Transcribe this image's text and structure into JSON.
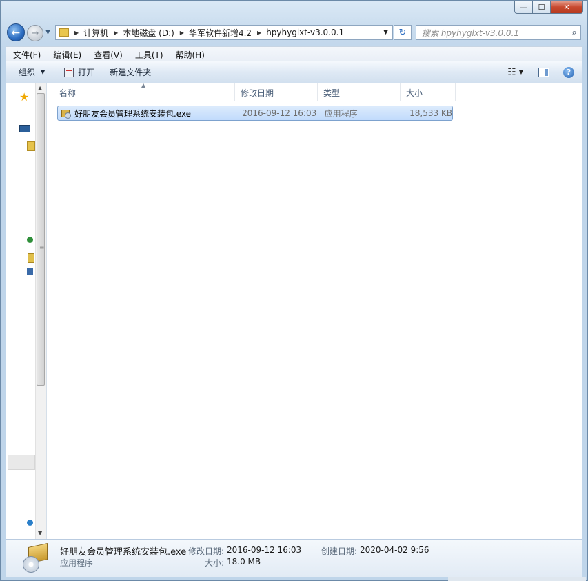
{
  "window": {
    "caption": {
      "minimize": "—",
      "maximize": "☐",
      "close": "✕"
    }
  },
  "nav": {
    "back_glyph": "←",
    "forward_glyph": "→",
    "breadcrumb": [
      "计算机",
      "本地磁盘 (D:)",
      "华军软件新增4.2",
      "hpyhyglxt-v3.0.0.1"
    ],
    "refresh_glyph": "↻",
    "search_placeholder": "搜索 hpyhyglxt-v3.0.0.1"
  },
  "menu": [
    "文件(F)",
    "编辑(E)",
    "查看(V)",
    "工具(T)",
    "帮助(H)"
  ],
  "toolbar": {
    "organize": "组织",
    "open": "打开",
    "new_folder": "新建文件夹",
    "help_glyph": "?"
  },
  "columns": {
    "name": "名称",
    "modified": "修改日期",
    "type": "类型",
    "size": "大小"
  },
  "files": [
    {
      "name": "好朋友会员管理系统安装包.exe",
      "modified": "2016-09-12 16:03",
      "type": "应用程序",
      "size": "18,533 KB"
    }
  ],
  "details": {
    "name": "好朋友会员管理系统安装包.exe",
    "type": "应用程序",
    "modified_label": "修改日期:",
    "modified_value": "2016-09-12 16:03",
    "created_label": "创建日期:",
    "created_value": "2020-04-02 9:56",
    "size_label": "大小:",
    "size_value": "18.0 MB"
  },
  "colors": {
    "selection": "#c1dbfc",
    "selection_border": "#7da2ce",
    "chrome": "#c9dff2"
  },
  "icons": [
    "back-arrow-icon",
    "forward-arrow-icon",
    "folder-icon",
    "refresh-icon",
    "search-icon",
    "open-icon",
    "view-icon",
    "preview-pane-icon",
    "help-icon",
    "favorites-star-icon",
    "desktop-icon",
    "library-icon",
    "homegroup-icon",
    "computer-icon",
    "network-icon",
    "installer-icon"
  ]
}
